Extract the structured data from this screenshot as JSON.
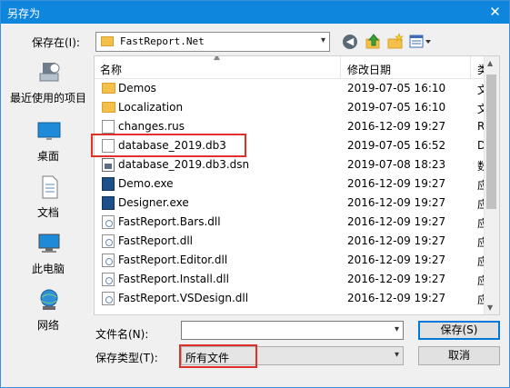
{
  "window": {
    "title": "另存为",
    "close_glyph": "✕"
  },
  "toolbar": {
    "save_in_label": "保存在(I):",
    "location": "FastReport.Net",
    "icons": [
      "back-icon",
      "up-folder-icon",
      "new-folder-icon",
      "view-menu-icon"
    ]
  },
  "places": [
    {
      "label": "最近使用的项目",
      "icon": "recent-icon"
    },
    {
      "label": "桌面",
      "icon": "desktop-icon"
    },
    {
      "label": "文档",
      "icon": "documents-icon"
    },
    {
      "label": "此电脑",
      "icon": "computer-icon"
    },
    {
      "label": "网络",
      "icon": "network-icon"
    }
  ],
  "list": {
    "columns": {
      "name": "名称",
      "date": "修改日期",
      "type": "类"
    },
    "rows": [
      {
        "name": "Demos",
        "date": "2019-07-05 16:10",
        "type": "文",
        "icon": "folder"
      },
      {
        "name": "Localization",
        "date": "2019-07-05 16:10",
        "type": "文",
        "icon": "folder"
      },
      {
        "name": "changes.rus",
        "date": "2016-12-09 19:27",
        "type": "RU",
        "icon": "doc"
      },
      {
        "name": "database_2019.db3",
        "date": "2019-07-05 16:52",
        "type": "DI",
        "icon": "doc"
      },
      {
        "name": "database_2019.db3.dsn",
        "date": "2019-07-08 18:23",
        "type": "数",
        "icon": "dsn"
      },
      {
        "name": "Demo.exe",
        "date": "2016-12-09 19:27",
        "type": "应",
        "icon": "exe"
      },
      {
        "name": "Designer.exe",
        "date": "2016-12-09 19:27",
        "type": "应",
        "icon": "exe"
      },
      {
        "name": "FastReport.Bars.dll",
        "date": "2016-12-09 19:27",
        "type": "应",
        "icon": "dll"
      },
      {
        "name": "FastReport.dll",
        "date": "2016-12-09 19:27",
        "type": "应",
        "icon": "dll"
      },
      {
        "name": "FastReport.Editor.dll",
        "date": "2016-12-09 19:27",
        "type": "应",
        "icon": "dll"
      },
      {
        "name": "FastReport.Install.dll",
        "date": "2016-12-09 19:27",
        "type": "应",
        "icon": "dll"
      },
      {
        "name": "FastReport.VSDesign.dll",
        "date": "2016-12-09 19:27",
        "type": "应",
        "icon": "dll"
      }
    ]
  },
  "form": {
    "filename_label": "文件名(N):",
    "filename_value": "",
    "filetype_label": "保存类型(T):",
    "filetype_value": "所有文件",
    "save_button": "保存(S)",
    "cancel_button": "取消"
  },
  "highlight_color": "#e0302a"
}
